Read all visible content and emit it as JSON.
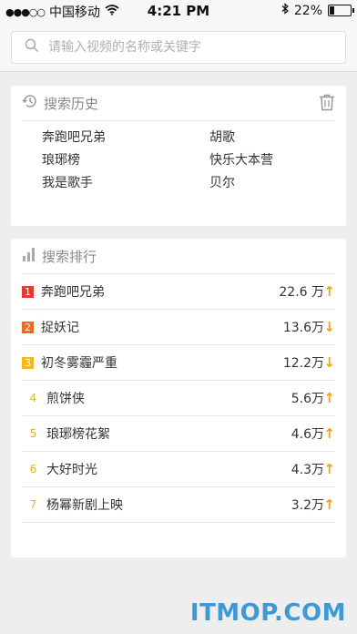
{
  "status_bar": {
    "signal": "●●●○○",
    "carrier": "中国移动",
    "time": "4:21 PM",
    "battery_text": "22%",
    "battery_level": 0.22
  },
  "search": {
    "placeholder": "请输入视频的名称或关键字"
  },
  "history": {
    "title": "搜索历史",
    "items": [
      "奔跑吧兄弟",
      "胡歌",
      "琅琊榜",
      "快乐大本营",
      "我是歌手",
      "贝尔"
    ]
  },
  "ranking": {
    "title": "搜索排行",
    "items": [
      {
        "rank": "1",
        "name": "奔跑吧兄弟",
        "value": "22.6 万",
        "trend": "up",
        "badge_color": "#e63a2e"
      },
      {
        "rank": "2",
        "name": "捉妖记",
        "value": "13.6万",
        "trend": "down",
        "badge_color": "#f26a1c"
      },
      {
        "rank": "3",
        "name": "初冬雾霾严重",
        "value": "12.2万",
        "trend": "down",
        "badge_color": "#f3b81c"
      },
      {
        "rank": "4",
        "name": "煎饼侠",
        "value": "5.6万",
        "trend": "up",
        "badge_color": ""
      },
      {
        "rank": "5",
        "name": "琅琊榜花絮",
        "value": "4.6万",
        "trend": "up",
        "badge_color": ""
      },
      {
        "rank": "6",
        "name": "大好时光",
        "value": "4.3万",
        "trend": "up",
        "badge_color": ""
      },
      {
        "rank": "7",
        "name": "杨幂新剧上映",
        "value": "3.2万",
        "trend": "up",
        "badge_color": ""
      }
    ]
  },
  "watermark": "ITMOP.COM",
  "colors": {
    "accent_arrow": "#f2a400",
    "background": "#eeeeee"
  }
}
